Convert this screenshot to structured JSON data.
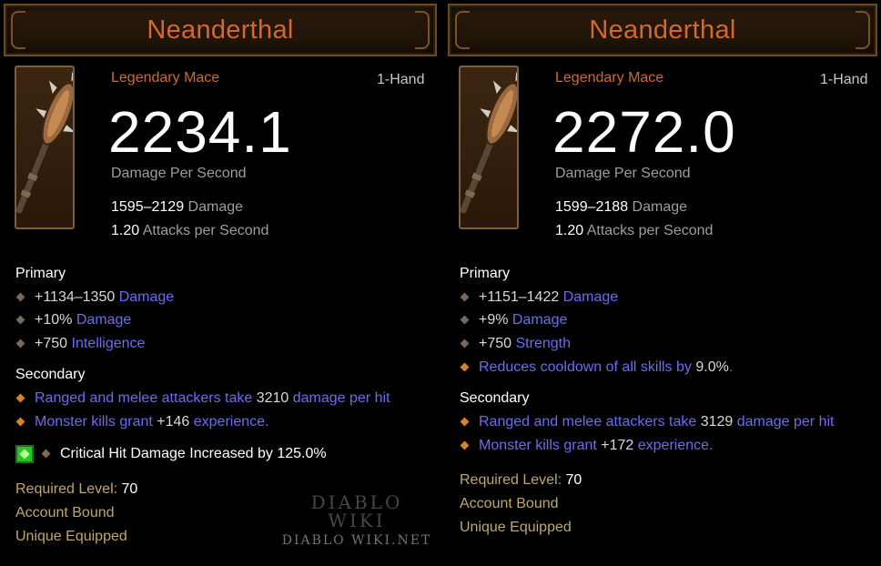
{
  "left": {
    "title": "Neanderthal",
    "item_type": "Legendary Mace",
    "slot": "1-Hand",
    "dps": "2234.1",
    "dps_label": "Damage Per Second",
    "damage_range": "1595–2129",
    "damage_word": "Damage",
    "attack_speed": "1.20",
    "attack_word": "Attacks per Second",
    "primary_label": "Primary",
    "primary": [
      {
        "value": "+1134–1350",
        "text": "Damage"
      },
      {
        "value": "+10%",
        "text": "Damage"
      },
      {
        "value": "+750",
        "text": "Intelligence"
      }
    ],
    "secondary_label": "Secondary",
    "secondary": [
      {
        "pre": "Ranged and melee attackers take ",
        "value": "3210",
        "post": " damage per hit"
      },
      {
        "pre": "Monster kills grant ",
        "value": "+146",
        "post": " experience."
      }
    ],
    "socket_text": "Critical Hit Damage Increased by 125.0%",
    "required_label": "Required Level:",
    "required_level": "70",
    "account_bound": "Account Bound",
    "unique_equipped": "Unique Equipped"
  },
  "right": {
    "title": "Neanderthal",
    "item_type": "Legendary Mace",
    "slot": "1-Hand",
    "dps": "2272.0",
    "dps_label": "Damage Per Second",
    "damage_range": "1599–2188",
    "damage_word": "Damage",
    "attack_speed": "1.20",
    "attack_word": "Attacks per Second",
    "primary_label": "Primary",
    "primary": [
      {
        "value": "+1151–1422",
        "text": "Damage"
      },
      {
        "value": "+9%",
        "text": "Damage"
      },
      {
        "value": "+750",
        "text": "Strength"
      }
    ],
    "primary_legendary": {
      "pre": "Reduces cooldown of all skills by ",
      "value": "9.0%",
      "post": "."
    },
    "secondary_label": "Secondary",
    "secondary": [
      {
        "pre": "Ranged and melee attackers take ",
        "value": "3129",
        "post": " damage per hit"
      },
      {
        "pre": "Monster kills grant ",
        "value": "+172",
        "post": " experience."
      }
    ],
    "required_label": "Required Level:",
    "required_level": "70",
    "account_bound": "Account Bound",
    "unique_equipped": "Unique Equipped"
  },
  "watermark": {
    "line1": "DIABLO",
    "line2": "WIKI",
    "line3": "DIABLO WIKI.NET"
  },
  "colors": {
    "legendary": "#d2692a",
    "affix_blue": "#6a6cf1",
    "gold": "#bfa76a"
  },
  "icons": {
    "item": "mace-icon",
    "socket": "emerald-gem-icon"
  }
}
